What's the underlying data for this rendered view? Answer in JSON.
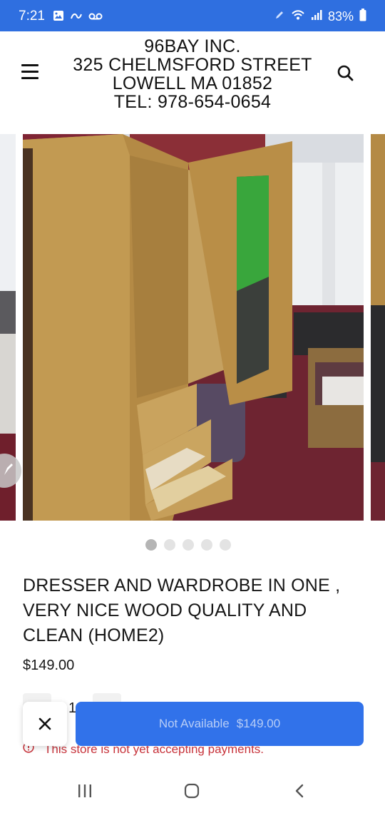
{
  "status_bar": {
    "time": "7:21",
    "battery": "83%",
    "left_icons": [
      "image-icon",
      "link-icon",
      "voicemail-icon"
    ],
    "right_icons": [
      "pen-icon",
      "wifi-icon",
      "signal-icon",
      "battery-icon"
    ]
  },
  "header": {
    "store_lines": [
      "96BAY INC.",
      "325 CHELMSFORD STREET",
      "LOWELL MA 01852",
      "TEL: 978-654-0654"
    ],
    "menu_icon": "hamburger-menu-icon",
    "search_icon": "search-icon"
  },
  "carousel": {
    "dot_count": 5,
    "active_index": 0
  },
  "product": {
    "title": "DRESSER AND WARDROBE IN ONE , VERY NICE WOOD QUALITY AND CLEAN (HOME2)",
    "price": "$149.00",
    "quantity": "1"
  },
  "cta": {
    "label": "Not Available",
    "price": "$149.00"
  },
  "notice": {
    "text": "This store is not yet accepting payments."
  },
  "colors": {
    "accent": "#3172ea",
    "status_bar": "#2f6fe0",
    "error": "#c7333b"
  },
  "nav": {
    "icons": [
      "recents-icon",
      "home-icon",
      "back-icon"
    ]
  }
}
